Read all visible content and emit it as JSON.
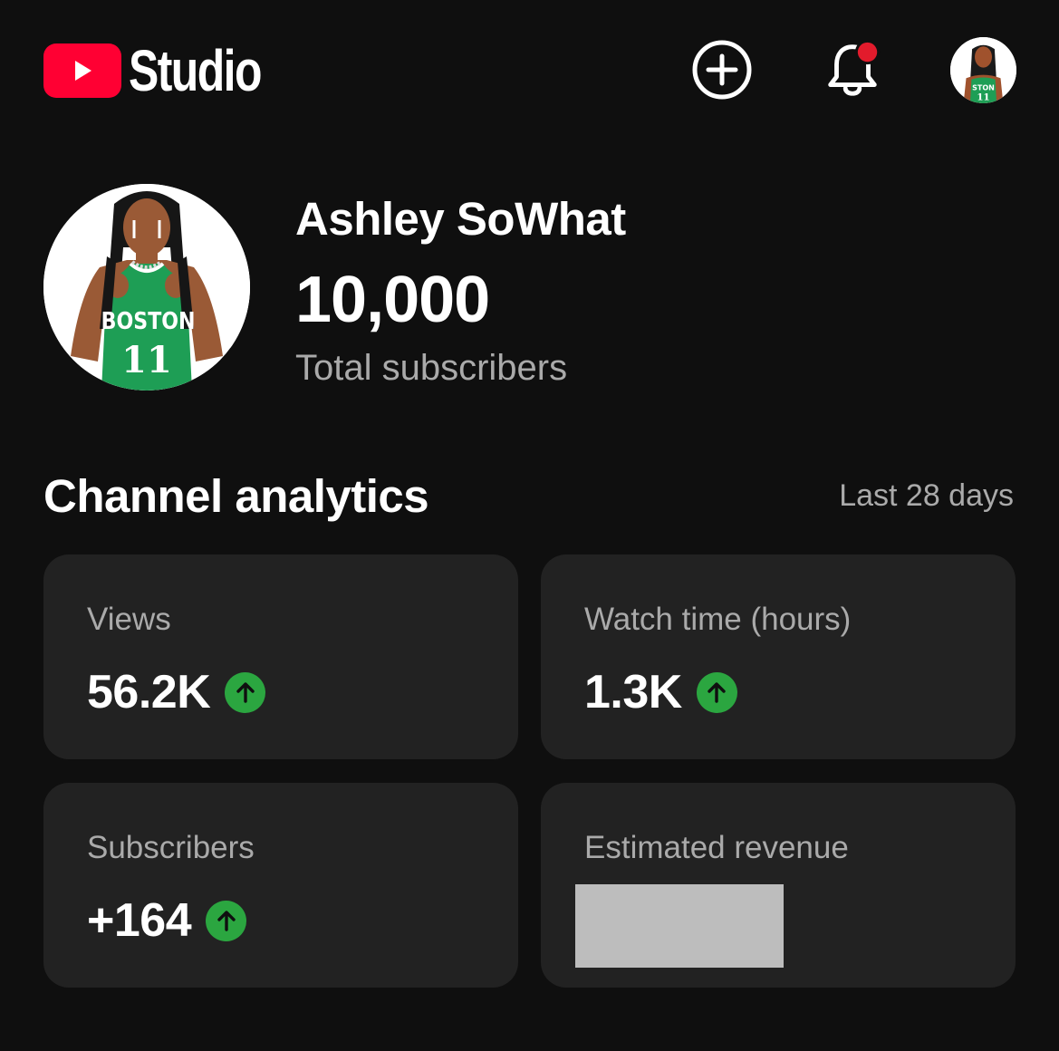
{
  "header": {
    "logo_text": "Studio",
    "create_icon": "create-plus-icon",
    "notification_icon": "bell-icon",
    "has_unread_notification": true
  },
  "profile": {
    "channel_name": "Ashley SoWhat",
    "subscriber_count": "10,000",
    "subscriber_label": "Total subscribers",
    "jersey_text": "BOSTON",
    "jersey_number": "11"
  },
  "analytics": {
    "title": "Channel analytics",
    "period": "Last 28 days",
    "cards": [
      {
        "label": "Views",
        "value": "56.2K",
        "trend": "up"
      },
      {
        "label": "Watch time (hours)",
        "value": "1.3K",
        "trend": "up"
      },
      {
        "label": "Subscribers",
        "value": "+164",
        "trend": "up"
      },
      {
        "label": "Estimated revenue",
        "value": "",
        "redacted": true
      }
    ]
  },
  "colors": {
    "background": "#0f0f0f",
    "card": "#222222",
    "brand_red": "#ff0033",
    "trend_green": "#2ba640",
    "secondary_text": "#aaaaaa"
  }
}
